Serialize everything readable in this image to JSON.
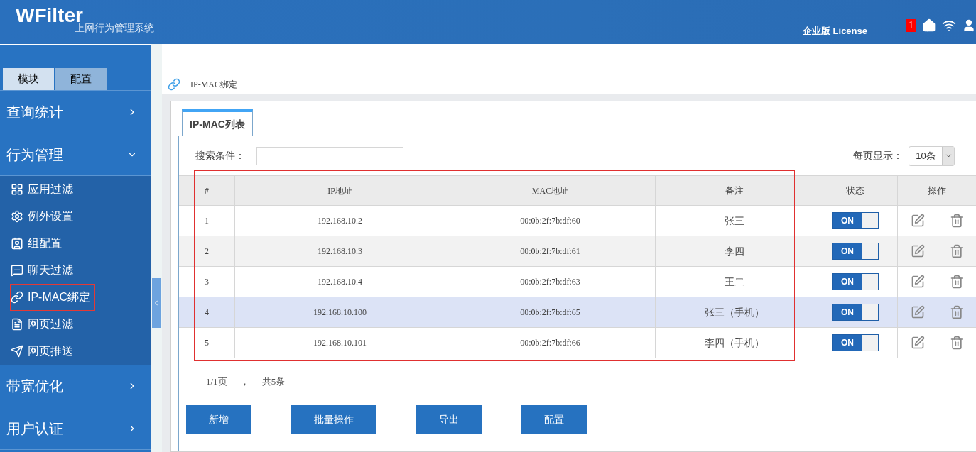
{
  "header": {
    "logo": "WFilter",
    "subtitle": "上网行为管理系统",
    "license": "企业版 License",
    "notification_count": "1"
  },
  "sidebar": {
    "tabs": [
      {
        "label": "模块",
        "selected": true
      },
      {
        "label": "配置",
        "selected": false
      }
    ],
    "sections": [
      {
        "label": "查询统计",
        "expanded": false
      },
      {
        "label": "行为管理",
        "expanded": true,
        "children": [
          {
            "label": "应用过滤",
            "selected": false
          },
          {
            "label": "例外设置",
            "selected": false
          },
          {
            "label": "组配置",
            "selected": false
          },
          {
            "label": "聊天过滤",
            "selected": false
          },
          {
            "label": "IP-MAC绑定",
            "selected": true
          },
          {
            "label": "网页过滤",
            "selected": false
          },
          {
            "label": "网页推送",
            "selected": false
          }
        ]
      },
      {
        "label": "带宽优化",
        "expanded": false
      },
      {
        "label": "用户认证",
        "expanded": false
      }
    ]
  },
  "breadcrumb": "IP-MAC绑定",
  "panel": {
    "tab": "IP-MAC列表",
    "search_label": "搜索条件：",
    "page_size_label": "每页显示：",
    "page_size": "10条",
    "table": {
      "columns": [
        "#",
        "IP地址",
        "MAC地址",
        "备注",
        "状态",
        "操作"
      ],
      "rows": [
        {
          "index": "1",
          "ip": "192.168.10.2",
          "mac": "00:0b:2f:7b:df:60",
          "note": "张三",
          "on": true,
          "toggle_label": "ON",
          "selected": false
        },
        {
          "index": "2",
          "ip": "192.168.10.3",
          "mac": "00:0b:2f:7b:df:61",
          "note": "李四",
          "on": true,
          "toggle_label": "ON",
          "selected": false
        },
        {
          "index": "3",
          "ip": "192.168.10.4",
          "mac": "00:0b:2f:7b:df:63",
          "note": "王二",
          "on": true,
          "toggle_label": "ON",
          "selected": false
        },
        {
          "index": "4",
          "ip": "192.168.10.100",
          "mac": "00:0b:2f:7b:df:65",
          "note": "张三（手机）",
          "on": true,
          "toggle_label": "ON",
          "selected": true
        },
        {
          "index": "5",
          "ip": "192.168.10.101",
          "mac": "00:0b:2f:7b:df:66",
          "note": "李四（手机）",
          "on": true,
          "toggle_label": "ON",
          "selected": false
        }
      ]
    },
    "pagination": {
      "pages": "1/1页",
      "separator": "，",
      "total": "共5条"
    },
    "buttons": [
      "新增",
      "批量操作",
      "导出",
      "配置"
    ]
  }
}
